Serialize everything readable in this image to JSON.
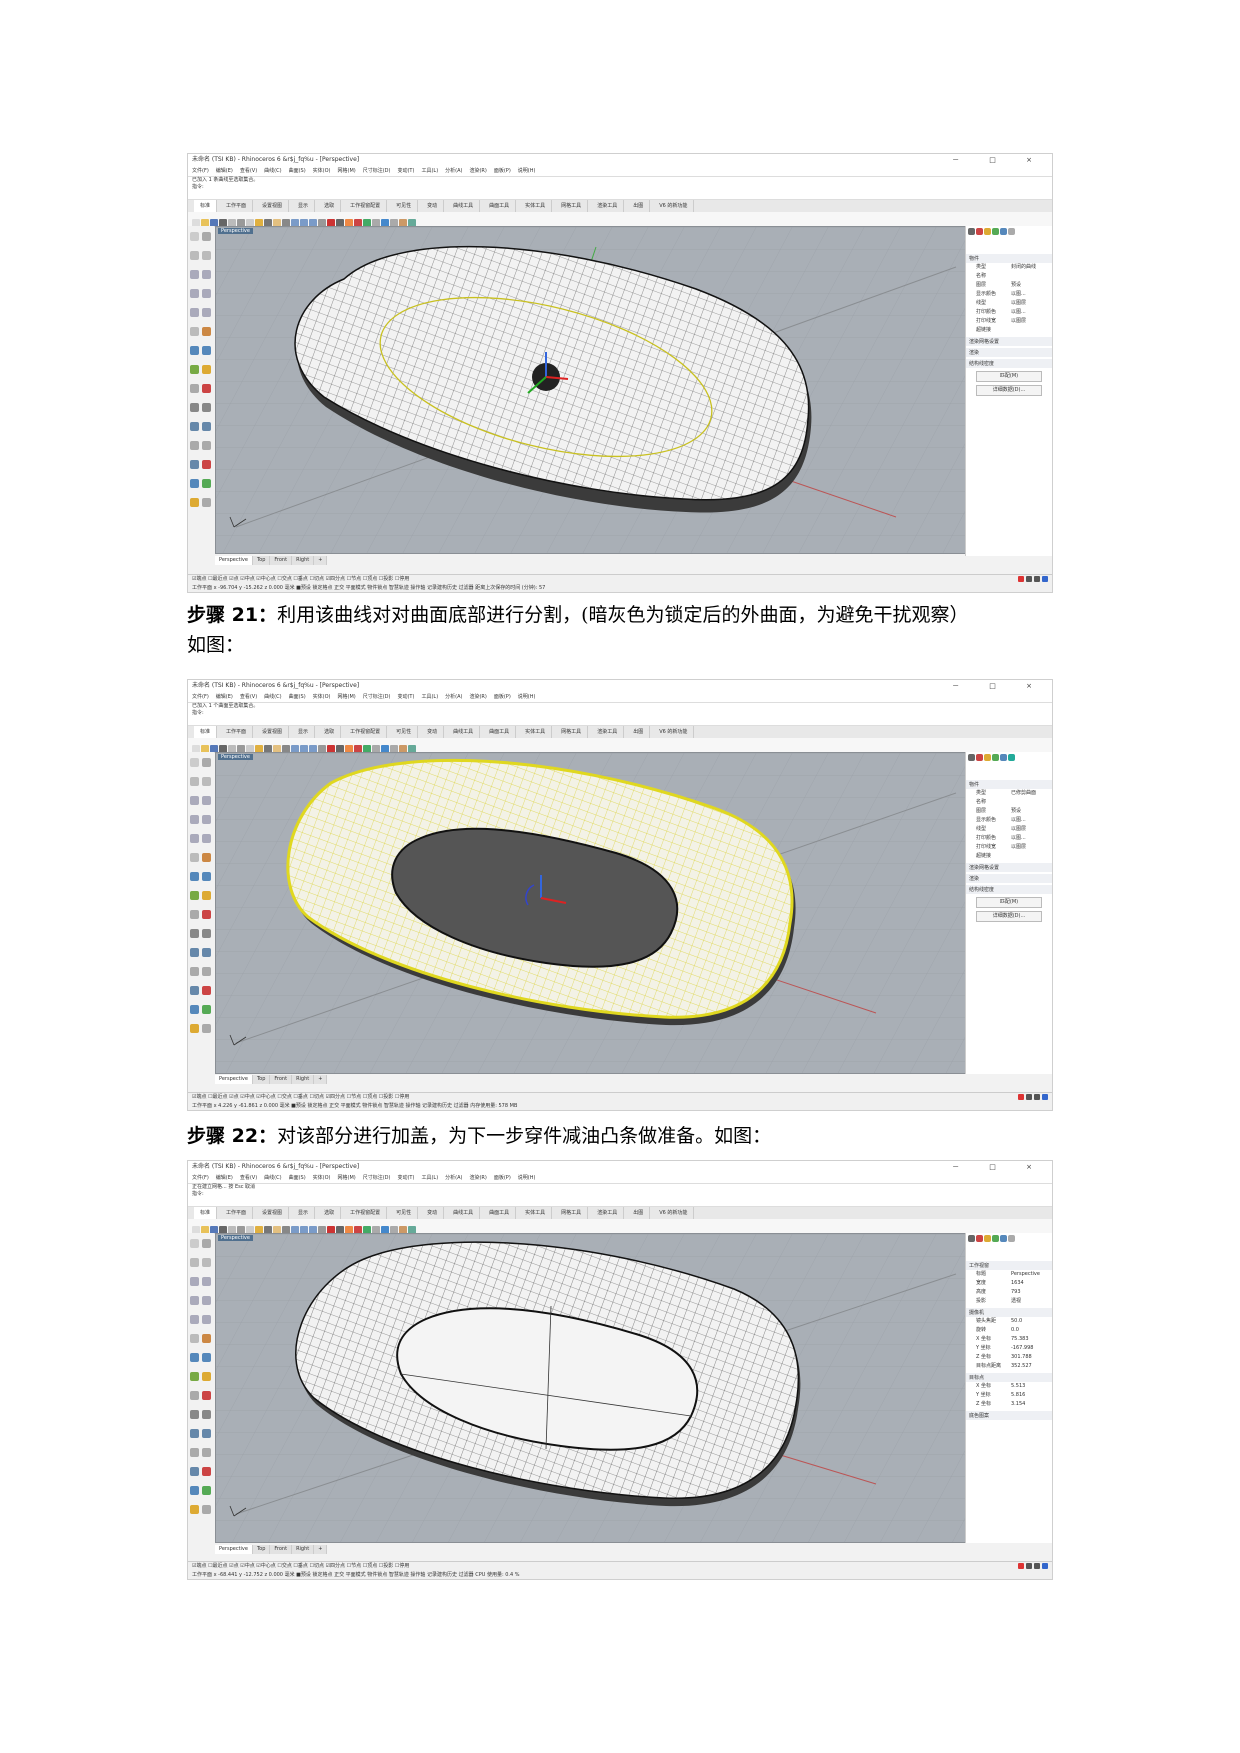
{
  "app": {
    "title": "未命名 (TSI KB) - Rhinoceros 6 &r$j_fq%u - [Perspective]",
    "menu": [
      "文件(F)",
      "编辑(E)",
      "查看(V)",
      "曲线(C)",
      "曲面(S)",
      "实体(O)",
      "网格(M)",
      "尺寸标注(D)",
      "变动(T)",
      "工具(L)",
      "分析(A)",
      "渲染(R)",
      "面板(P)",
      "说明(H)"
    ],
    "tabs": [
      "标准",
      "工作平面",
      "设置视图",
      "显示",
      "选取",
      "工作视窗配置",
      "可见性",
      "变动",
      "曲线工具",
      "曲面工具",
      "实体工具",
      "网格工具",
      "渲染工具",
      "出图",
      "V6 的新功能"
    ],
    "viewport_label": "Perspective",
    "viewport_tabs": [
      "Perspective",
      "Top",
      "Front",
      "Right",
      "+"
    ],
    "window_buttons": "－ □ ×"
  },
  "shot1": {
    "cmd_lines": [
      "已加入 1 条曲线至选取集合。",
      "指令:"
    ],
    "panel": {
      "header": "物件",
      "rows": [
        {
          "k": "类型",
          "v": "封闭的曲线"
        },
        {
          "k": "名称",
          "v": ""
        },
        {
          "k": "图层",
          "v": "预设"
        },
        {
          "k": "显示颜色",
          "v": "以图..."
        },
        {
          "k": "线型",
          "v": "以图层"
        },
        {
          "k": "打印颜色",
          "v": "以图..."
        },
        {
          "k": "打印线宽",
          "v": "以图层"
        },
        {
          "k": "超链接",
          "v": ""
        }
      ],
      "sections": [
        "渲染网格设置",
        "渲染",
        "结构线密度"
      ],
      "buttons": [
        "匹配(M)",
        "详细数据(D)..."
      ]
    },
    "status": "工作平面  x -96.704  y -15.262  z 0.000  毫米  ■预设  锁定格点  正交  平面模式  物件锁点  智慧轨迹  操作轴  记录建构历史  过滤器  距离上次保存的时间 (分钟): 57"
  },
  "shot2": {
    "cmd_lines": [
      "已加入 1 个曲面至选取集合。",
      "指令:"
    ],
    "panel": {
      "header": "物件",
      "rows": [
        {
          "k": "类型",
          "v": "已修剪曲面"
        },
        {
          "k": "名称",
          "v": ""
        },
        {
          "k": "图层",
          "v": "预设"
        },
        {
          "k": "显示颜色",
          "v": "以图..."
        },
        {
          "k": "线型",
          "v": "以图层"
        },
        {
          "k": "打印颜色",
          "v": "以图..."
        },
        {
          "k": "打印线宽",
          "v": "以图层"
        },
        {
          "k": "超链接",
          "v": ""
        }
      ],
      "sections": [
        "渲染网格设置",
        "渲染",
        "结构线密度"
      ],
      "buttons": [
        "匹配(M)",
        "详细数据(D)..."
      ]
    },
    "status": "工作平面  x 4.226  y -61.861  z 0.000  毫米  ■预设  锁定格点  正交  平面模式  物件锁点  智慧轨迹  操作轴  记录建构历史  过滤器  内存使用量: 578 MB"
  },
  "shot3": {
    "cmd_lines": [
      "正在建立网格... 按 Esc 取消",
      "指令:"
    ],
    "panel": {
      "header": "工作视窗",
      "rows": [
        {
          "k": "标题",
          "v": "Perspective"
        },
        {
          "k": "宽度",
          "v": "1634"
        },
        {
          "k": "高度",
          "v": "793"
        },
        {
          "k": "投影",
          "v": "透视"
        }
      ],
      "sections": [
        "摄像机"
      ],
      "camera": [
        {
          "k": "镜头焦距",
          "v": "50.0"
        },
        {
          "k": "旋转",
          "v": "0.0"
        },
        {
          "k": "X 坐标",
          "v": "75.383"
        },
        {
          "k": "Y 坐标",
          "v": "-167.998"
        },
        {
          "k": "Z 坐标",
          "v": "301.788"
        },
        {
          "k": "目标点距离",
          "v": "352.527"
        }
      ],
      "target_header": "目标点",
      "target": [
        {
          "k": "X 坐标",
          "v": "5.513"
        },
        {
          "k": "Y 坐标",
          "v": "5.816"
        },
        {
          "k": "Z 坐标",
          "v": "3.154"
        }
      ],
      "extra_header": "底色图案"
    },
    "status": "工作平面  x -68.441  y -12.752  z 0.000  毫米  ■预设  锁定格点  正交  平面模式  物件锁点  智慧轨迹  操作轴  记录建构历史  过滤器  CPU 使用量: 0.4 %"
  },
  "osnap": "☑端点 ☐最近点 ☑点 ☑中点 ☑中心点 ☐交点 ☐垂点 ☐切点 ☑四分点 ☐节点 ☐顶点 ☐投影 ☐停用",
  "captions": {
    "step21_label": "步骤 21：",
    "step21_text": "利用该曲线对对曲面底部进行分割，(暗灰色为锁定后的外曲面，为避免干扰观察）",
    "step21_text2": "如图：",
    "step22_label": "步骤 22：",
    "step22_text": "对该部分进行加盖，为下一步穿件减油凸条做准备。如图："
  }
}
